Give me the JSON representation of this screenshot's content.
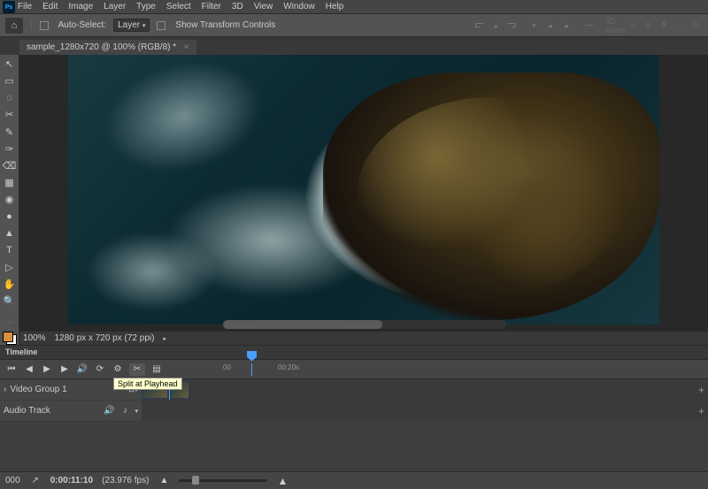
{
  "app_logo": "Ps",
  "menu": [
    "File",
    "Edit",
    "Image",
    "Layer",
    "Type",
    "Select",
    "Filter",
    "3D",
    "View",
    "Window",
    "Help"
  ],
  "options": {
    "auto_select": "Auto-Select:",
    "auto_select_target": "Layer",
    "show_transform": "Show Transform Controls",
    "mode_3d": "3D Mode:"
  },
  "doc_tab": {
    "title": "sample_1280x720 @ 100% (RGB/8) *",
    "close": "×"
  },
  "tools": [
    "↖",
    "▭",
    "◌",
    "✂",
    "✎",
    "✑",
    "⌫",
    "▦",
    "◉",
    "●",
    "▲",
    "T",
    "▷",
    "✋",
    "🔍"
  ],
  "status": {
    "zoom": "100%",
    "info": "1280 px x 720 px (72 ppi)"
  },
  "timeline": {
    "title": "Timeline",
    "ruler": {
      "t0": "00",
      "t1": "00:20s"
    },
    "video_label": "Video Group 1",
    "audio_label": "Audio Track",
    "tooltip": "Split at Playhead",
    "frame_counter": "000",
    "time": "0:00:11:10",
    "fps": "(23.976 fps)"
  },
  "icons": {
    "home": "⌂",
    "prev": "⏮",
    "back": "◀",
    "play": "▶",
    "fwd": "▶",
    "next": "⏭",
    "vol": "🔊",
    "loop": "⟳",
    "gear": "⚙",
    "scissors": "✂",
    "trans": "▤",
    "arrow_r": "›",
    "plus": "+",
    "note": "♪",
    "export": "↗",
    "mtn1": "▲",
    "mtn2": "▲"
  }
}
